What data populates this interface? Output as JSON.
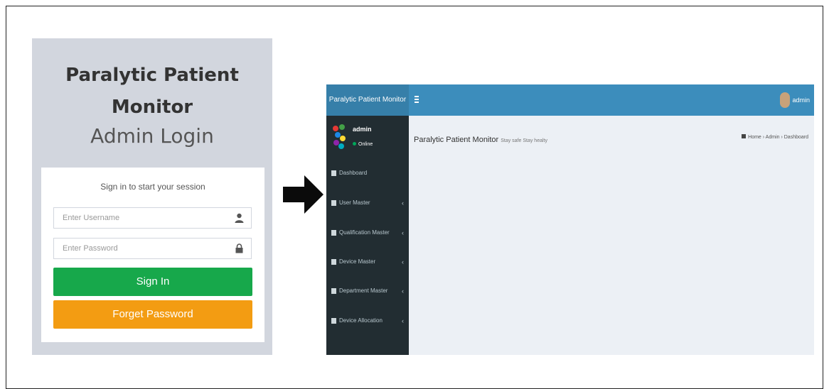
{
  "login": {
    "title_line1": "Paralytic Patient",
    "title_line2": "Monitor",
    "subtitle": "Admin Login",
    "message": "Sign in to start your session",
    "username_placeholder": "Enter Username",
    "password_placeholder": "Enter Password",
    "signin_label": "Sign In",
    "forget_label": "Forget Password",
    "colors": {
      "signin": "#17a84b",
      "forget": "#f39c12",
      "panel_bg": "#d2d6de"
    },
    "icons": {
      "username": "user-icon",
      "password": "lock-icon"
    }
  },
  "arrow": {
    "icon": "arrow-right-icon"
  },
  "dashboard": {
    "logo": "Paralytic Patient Monitor",
    "nav_user": "admin",
    "sidebar": {
      "user_name": "admin",
      "status": "Online",
      "items": [
        {
          "label": "Dashboard",
          "icon": "dashboard-icon",
          "has_chevron": false
        },
        {
          "label": "User Master",
          "icon": "users-icon",
          "has_chevron": true
        },
        {
          "label": "Qualification Master",
          "icon": "graduation-cap-icon",
          "has_chevron": true
        },
        {
          "label": "Device Master",
          "icon": "cogs-icon",
          "has_chevron": true
        },
        {
          "label": "Department Master",
          "icon": "building-icon",
          "has_chevron": true
        },
        {
          "label": "Device Allocation",
          "icon": "graduation-cap-icon",
          "has_chevron": true
        }
      ]
    },
    "content_title": "Paralytic Patient Monitor",
    "content_subtitle": "Stay safe Stay healty",
    "breadcrumb": {
      "home": "Home",
      "admin": "Admin",
      "current": "Dashboard"
    },
    "colors": {
      "header": "#3c8dbc",
      "logo_bg": "#367fa9",
      "sidebar": "#222d32",
      "content": "#ecf0f5"
    }
  }
}
